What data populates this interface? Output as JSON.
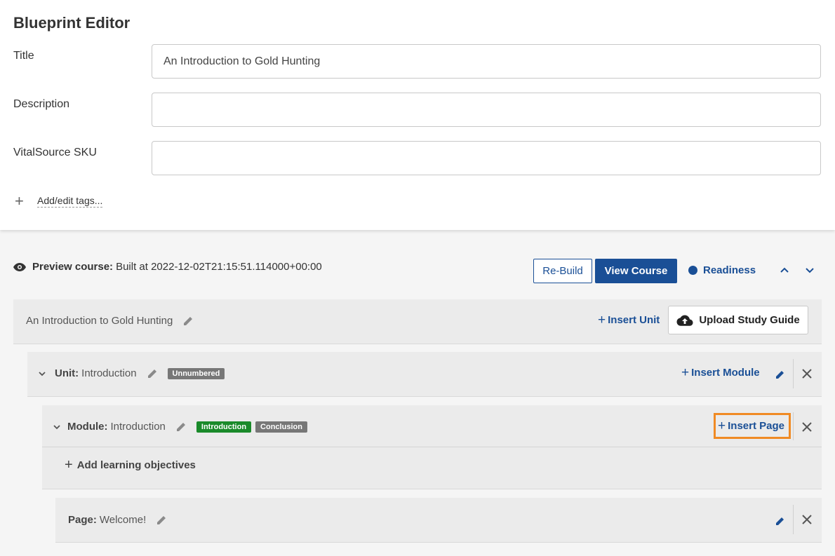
{
  "editor": {
    "title": "Blueprint Editor",
    "fields": {
      "title_label": "Title",
      "title_value": "An Introduction to Gold Hunting",
      "description_label": "Description",
      "description_value": "",
      "sku_label": "VitalSource SKU",
      "sku_value": ""
    },
    "tags_link": "Add/edit tags..."
  },
  "preview": {
    "label": "Preview course:",
    "built_text": "Built at 2022-12-02T21:15:51.114000+00:00",
    "rebuild_label": "Re-Build",
    "view_course_label": "View Course",
    "readiness_label": "Readiness"
  },
  "course": {
    "title": "An Introduction to Gold Hunting",
    "insert_unit_label": "Insert Unit",
    "upload_label": "Upload Study Guide"
  },
  "unit": {
    "prefix": "Unit:",
    "name": "Introduction",
    "badge": "Unnumbered",
    "insert_module_label": "Insert Module"
  },
  "module": {
    "prefix": "Module:",
    "name": "Introduction",
    "badges": [
      "Introduction",
      "Conclusion"
    ],
    "insert_page_label": "Insert Page",
    "add_objectives_label": "Add learning objectives"
  },
  "page": {
    "prefix": "Page:",
    "name": "Welcome!"
  },
  "colors": {
    "primary": "#1a4f96",
    "highlight": "#f08a24",
    "badge_green": "#1a8a2a",
    "badge_gray": "#777777"
  }
}
